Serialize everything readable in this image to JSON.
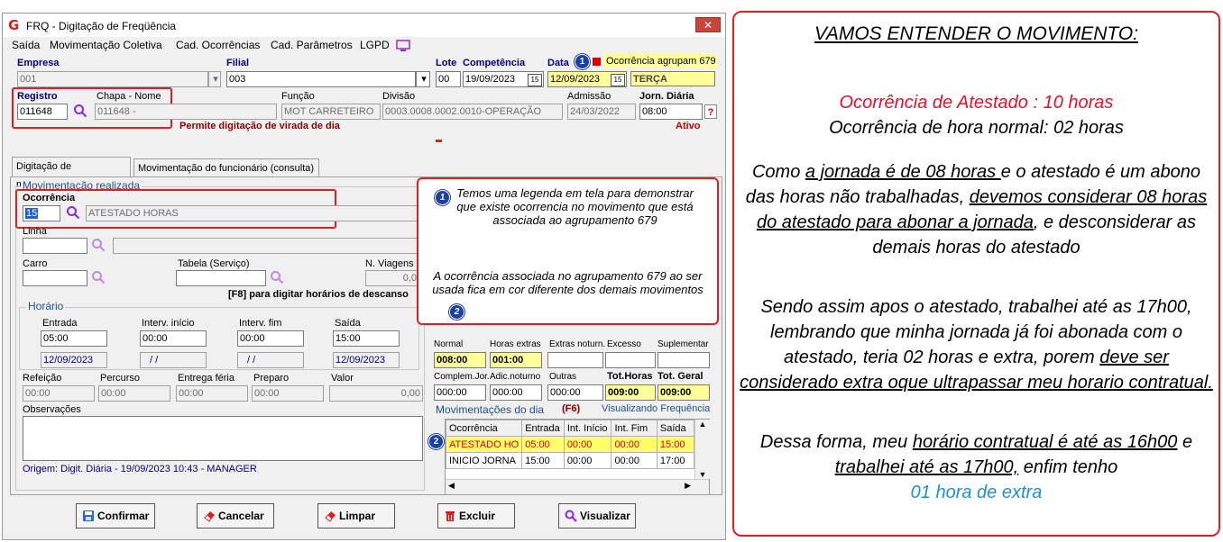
{
  "window": {
    "title": "FRQ - Digitação de Freqüência",
    "close_glyph": "✕",
    "logo_glyph": "G"
  },
  "menu": [
    "Saída",
    "Movimentação Coletiva",
    "Cad. Ocorrências",
    "Cad. Parâmetros",
    "LGPD"
  ],
  "header": {
    "empresa_label": "Empresa",
    "empresa_value": "001",
    "filial_label": "Filial",
    "filial_value": "003",
    "lote_label": "Lote",
    "lote_value": "00",
    "competencia_label": "Competência",
    "competencia_value": "19/09/2023",
    "data_label": "Data",
    "data_value": "12/09/2023",
    "weekday": "TERÇA",
    "legend_text": "Ocorrência agrupam 679",
    "legend_color": "#e00000",
    "registro_label": "Registro",
    "registro_value": "011648",
    "chapa_nome_label": "Chapa  -  Nome",
    "chapa_nome_value": "011648 -",
    "funcao_label": "Função",
    "funcao_value": "MOT CARRETEIRO",
    "divisao_label": "Divisão",
    "divisao_value": "0003.0008.0002.0010-OPERAÇÃO",
    "admissao_label": "Admissão",
    "admissao_value": "24/03/2022",
    "jornada_label": "Jorn. Diária",
    "jornada_value": "08:00",
    "help_glyph": "?",
    "virada_text": "Permite digitação de virada de dia",
    "status_text": "Ativo"
  },
  "tabs": [
    "Digitação de movimentos",
    "Movimentação do funcionário (consulta)"
  ],
  "movimentacao": {
    "group_title": "Movimentação realizada",
    "ocorrencia_label": "Ocorrência",
    "ocorrencia_code": "15",
    "ocorrencia_desc": "ATESTADO HORAS",
    "linha_label": "Linha",
    "carro_label": "Carro",
    "tabela_label": "Tabela (Serviço)",
    "viagens_label": "N. Viagens",
    "viagens_value": "0,0",
    "f8_text": "[F8] para digitar horários de descanso",
    "horario_title": "Horário",
    "entrada_label": "Entrada",
    "entrada_value": "05:00",
    "entrada_date": "12/09/2023",
    "int_inicio_label": "Interv. início",
    "int_inicio_value": "00:00",
    "int_inicio_date": "/ /",
    "int_fim_label": "Interv. fim",
    "int_fim_value": "00:00",
    "int_fim_date": "/ /",
    "saida_label": "Saída",
    "saida_value": "15:00",
    "saida_date": "12/09/2023",
    "refeicao_label": "Refeição",
    "refeicao_value": "00:00",
    "percurso_label": "Percurso",
    "percurso_value": "00:00",
    "entrega_label": "Entrega féria",
    "entrega_value": "00:00",
    "preparo_label": "Preparo",
    "preparo_value": "00:00",
    "valor_label": "Valor",
    "valor_value": "0,00",
    "obs_label": "Observações",
    "origem_text": "Origem: Digit. Diária - 19/09/2023 10:43 - MANAGER"
  },
  "totais": {
    "normal_label": "Normal",
    "normal_value": "008:00",
    "extras_label": "Horas extras",
    "extras_value": "001:00",
    "noturnas_label": "Extras noturn.",
    "noturnas_value": "",
    "excesso_label": "Excesso",
    "excesso_value": "",
    "suplementar_label": "Suplementar",
    "complem_label": "Complem.Jor.",
    "complem_value": "000:00",
    "adic_label": "Adic.noturno",
    "adic_value": "000:00",
    "outras_label": "Outras",
    "outras_value": "000:00",
    "tot_horas_label": "Tot.Horas",
    "tot_horas_value": "009:00",
    "tot_geral_label": "Tot. Geral",
    "tot_geral_value": "009:00"
  },
  "movdia": {
    "title": "Movimentações do dia",
    "f6": "(F6)",
    "visualizando": "Visualizando Frequência",
    "columns": [
      "Ocorrência",
      "Entrada",
      "Int. Início",
      "Int. Fim",
      "Saída"
    ],
    "rows": [
      {
        "ocorrencia": "ATESTADO HO",
        "entrada": "05:00",
        "int_inicio": "00:00",
        "int_fim": "00:00",
        "saida": "15:00"
      },
      {
        "ocorrencia": "INICIO JORNA",
        "entrada": "15:00",
        "int_inicio": "00:00",
        "int_fim": "00:00",
        "saida": "17:00"
      }
    ]
  },
  "buttons": [
    "Confirmar",
    "Cancelar",
    "Limpar",
    "Excluir",
    "Visualizar"
  ],
  "callout": {
    "num1": "1",
    "num2": "2",
    "text1": "Temos uma legenda em tela para demonstrar que existe ocorrencia no movimento que está associada ao agrupamento 679",
    "text2": "A ocorrência associada no agrupamento 679 ao ser usada fica em cor diferente dos demais movimentos"
  },
  "explanation": {
    "title": "VAMOS ENTENDER O MOVIMENTO:",
    "line_atestado": "Ocorrência de Atestado : 10 horas",
    "line_normal": "Ocorrência de hora normal: 02 horas",
    "p1_a": "Como ",
    "p1_b": "a jornada é de 08 horas ",
    "p1_c": "e o atestado é um abono das horas não trabalhadas, ",
    "p1_d": "devemos considerar 08 horas do atestado para abonar a jornada",
    "p1_e": ", e desconsiderar as demais horas do atestado",
    "p2_a": "Sendo assim apos o atestado, trabalhei até as 17h00, lembrando que minha jornada já foi abonada com o atestado, teria 02 horas e extra, porem ",
    "p2_b": "deve ser considerado extra oque ultrapassar meu horario contratual.",
    "p3_a": "Dessa forma, meu ",
    "p3_b": "horário contratual é até as 16h00",
    "p3_c": " e ",
    "p3_d": "trabalhei até as 17h00,",
    "p3_e": " enfim tenho",
    "p3_f": "01 hora de extra"
  },
  "colors": {
    "red_accent": "#e02020",
    "atestado_red": "#e8102a",
    "highlight_row": "#ffff66",
    "blue_text": "#1a8fe0"
  }
}
